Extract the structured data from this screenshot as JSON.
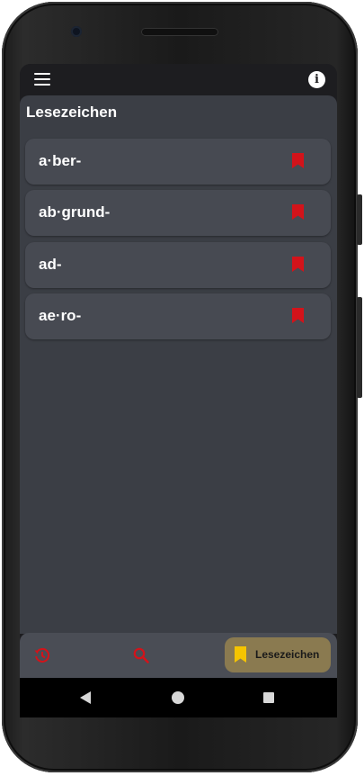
{
  "page_title": "Lesezeichen",
  "entries": [
    {
      "label": "a·ber-"
    },
    {
      "label": "ab·grund-"
    },
    {
      "label": "ad-"
    },
    {
      "label": "ae·ro-"
    }
  ],
  "bottom_nav": {
    "items": [
      {
        "icon": "history-icon",
        "label": ""
      },
      {
        "icon": "search-icon",
        "label": ""
      },
      {
        "icon": "bookmark-icon",
        "label": "Lesezeichen",
        "active": true
      }
    ]
  },
  "colors": {
    "accent_red": "#d3131a",
    "active_bg": "#8a7a50",
    "active_icon": "#f5c400",
    "surface": "#3b3e45",
    "card": "#474a52"
  }
}
